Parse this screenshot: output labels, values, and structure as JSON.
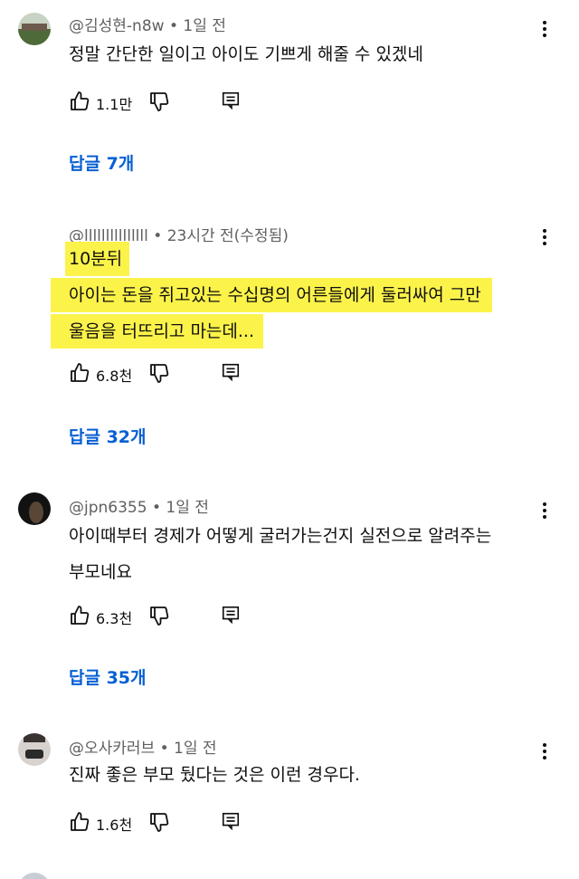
{
  "comments": [
    {
      "author": "@김성현-n8w",
      "time": "1일 전",
      "lines": [
        "정말 간단한 일이고 아이도 기쁘게 해줄 수 있겠네"
      ],
      "likes": "1.1만",
      "replies": "답글 7개",
      "avatar_colors": [
        "#6c7a64",
        "#3f5a2c"
      ]
    },
    {
      "author": "@lllllllllllllll",
      "time": "23시간 전(수정됨)",
      "lines": [
        "10분뒤",
        "아이는 돈을 쥐고있는 수십명의 어른들에게 둘러싸여 그만",
        "울음을 터뜨리고 마는데..."
      ],
      "likes": "6.8천",
      "replies": "답글 32개",
      "highlight_color": "#fcf34a"
    },
    {
      "author": "@jpn6355",
      "time": "1일 전",
      "lines": [
        "아이때부터 경제가 어떻게 굴러가는건지 실전으로 알려주는",
        "부모네요"
      ],
      "likes": "6.3천",
      "replies": "답글 35개",
      "avatar_colors": [
        "#1a1a1a",
        "#4a3a2a"
      ]
    },
    {
      "author": "@오사카러브",
      "time": "1일 전",
      "lines": [
        "진짜 좋은 부모 뒀다는 것은 이런 경우다."
      ],
      "likes": "1.6천",
      "avatar_colors": [
        "#d8d2ce",
        "#2a2a2a"
      ]
    }
  ],
  "icons": {
    "like": "thumbs-up-icon",
    "dislike": "thumbs-down-icon",
    "reply": "reply-icon",
    "menu": "more-vert-icon"
  },
  "accent_color": "#065fd4"
}
